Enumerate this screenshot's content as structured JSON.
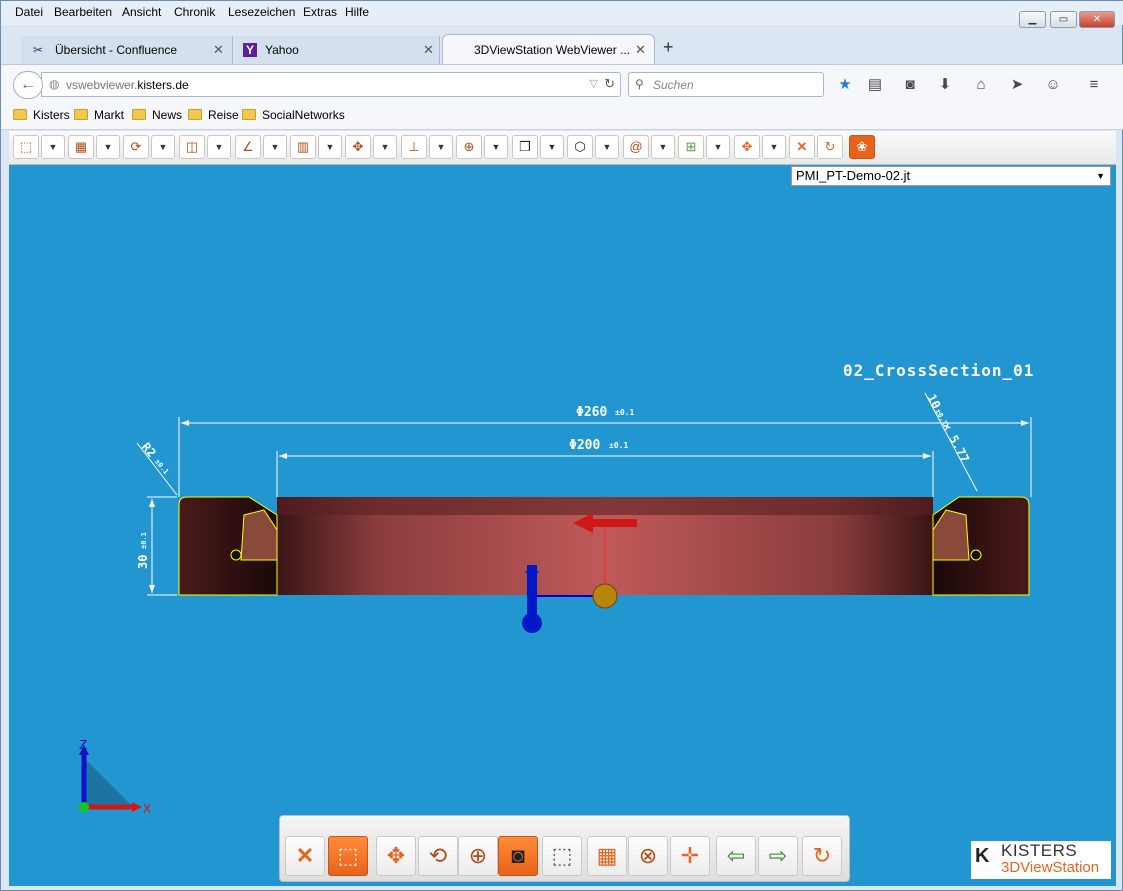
{
  "menu": [
    "Datei",
    "Bearbeiten",
    "Ansicht",
    "Chronik",
    "Lesezeichen",
    "Extras",
    "Hilfe"
  ],
  "tabs": [
    {
      "label": "Übersicht - Confluence",
      "icon": "confluence-icon",
      "active": false
    },
    {
      "label": "Yahoo",
      "icon": "yahoo-icon",
      "active": false
    },
    {
      "label": "3DViewStation WebViewer ...",
      "icon": "",
      "active": true
    }
  ],
  "nav": {
    "url_prefix": "vswebviewer.",
    "url_domain": "kisters.de",
    "search_placeholder": "Suchen"
  },
  "bookmarks": [
    "Kisters",
    "Markt",
    "News",
    "Reise",
    "SocialNetworks"
  ],
  "viewer": {
    "model_select": "PMI_PT-Demo-02.jt",
    "cross_section_label": "02_CrossSection_01",
    "dimensions": {
      "outer_diameter": "Φ260",
      "outer_tol": "±0.1",
      "inner_diameter": "Φ200",
      "inner_tol": "±0.1",
      "radius": "R2",
      "radius_tol": "±0.1",
      "height": "30",
      "height_tol": "±0.1",
      "chamfer": "10",
      "chamfer_tol": "±0.1",
      "chamfer_angle": "× 5.77"
    },
    "axes": {
      "z": "Z",
      "x": "X"
    }
  },
  "logo": {
    "line1": "KISTERS",
    "line2": "3DViewStation"
  },
  "colors": {
    "viewport_bg": "#2196d0",
    "accent_orange": "#e9621a",
    "section_face": "#b85a5a",
    "section_edge": "#3a1414",
    "dimension_line": "#ffffff",
    "outline": "#ffff00"
  }
}
